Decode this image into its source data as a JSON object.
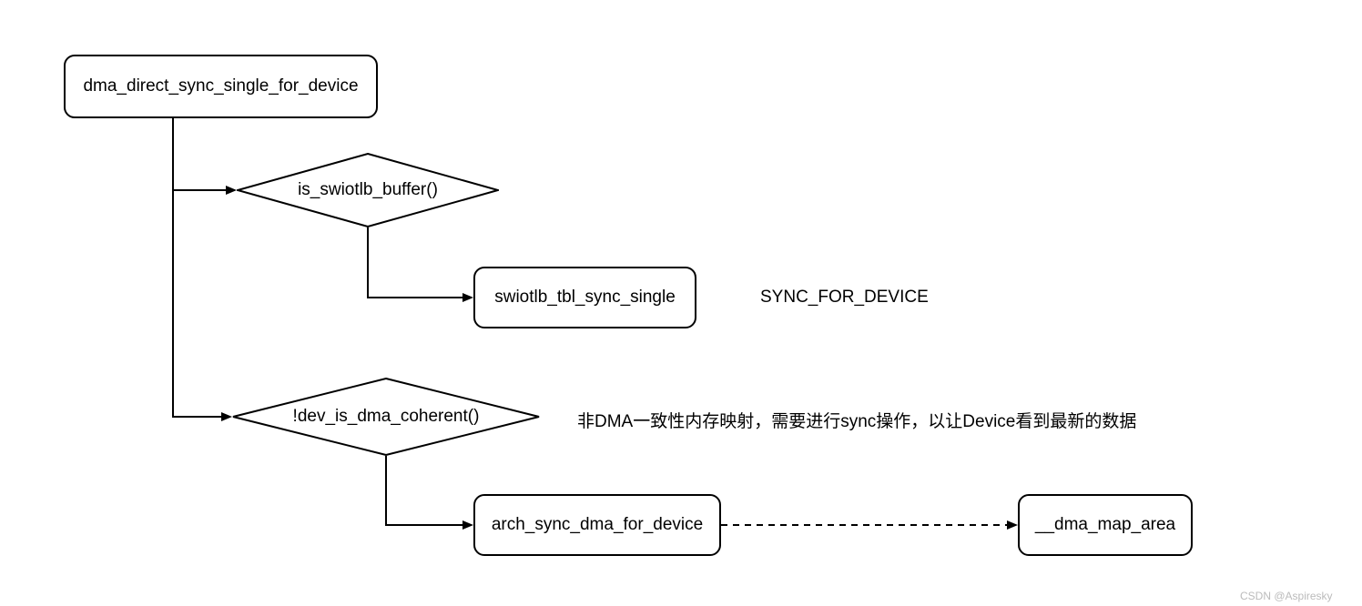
{
  "nodes": {
    "root": "dma_direct_sync_single_for_device",
    "decision1": "is_swiotlb_buffer()",
    "action1": "swiotlb_tbl_sync_single",
    "annot1": "SYNC_FOR_DEVICE",
    "decision2": "!dev_is_dma_coherent()",
    "annot2": "非DMA一致性内存映射，需要进行sync操作，以让Device看到最新的数据",
    "action2": "arch_sync_dma_for_device",
    "action3": "__dma_map_area"
  },
  "watermark": "CSDN @Aspiresky"
}
